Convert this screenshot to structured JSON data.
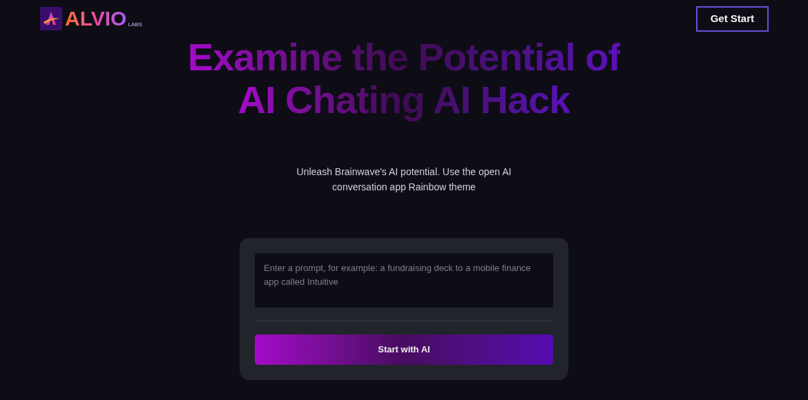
{
  "header": {
    "logo": {
      "wordmark": "ALVIO",
      "tagline": "LABS"
    },
    "cta": "Get Start"
  },
  "hero": {
    "title_lines": [
      "Examine the Potential of",
      "AI Chating AI Hack"
    ],
    "subtitle": "Unleash Brainwave's AI potential. Use the open AI conversation app Rainbow theme"
  },
  "prompt_card": {
    "placeholder": "Enter a prompt, for example: a fundraising deck to a mobile finance app called Intuitive",
    "button": "Start with AI"
  }
}
